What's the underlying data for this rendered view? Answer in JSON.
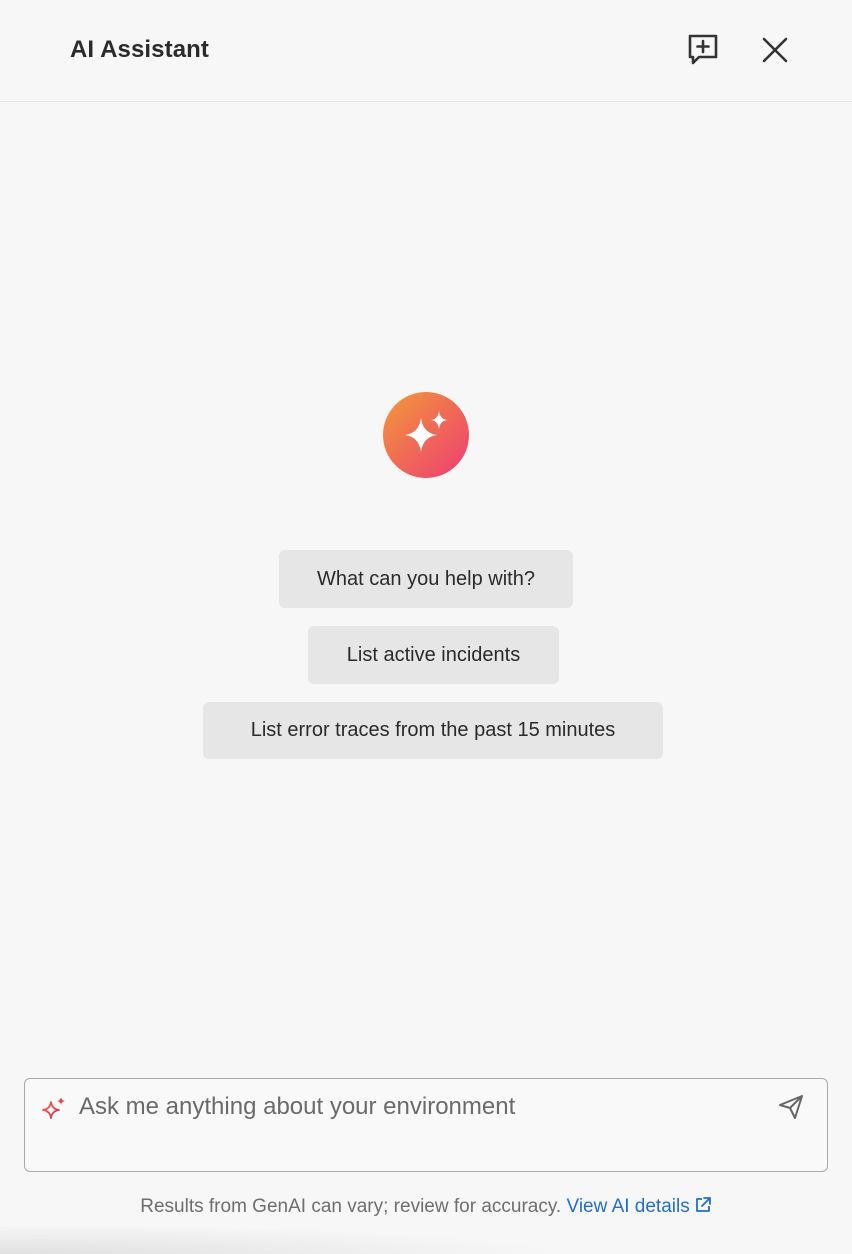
{
  "header": {
    "title": "AI Assistant",
    "new_chat_icon": "new-chat-icon",
    "close_icon": "close-icon"
  },
  "empty_state": {
    "logo_icon": "sparkle-icon",
    "suggestions": [
      "What can you help with?",
      "List active incidents",
      "List error traces from the past 15 minutes"
    ]
  },
  "input": {
    "placeholder": "Ask me anything about your environment",
    "value": "",
    "leading_icon": "sparkle-icon",
    "send_icon": "send-icon"
  },
  "footer": {
    "disclaimer": "Results from GenAI can vary; review for accuracy.",
    "link_label": "View AI details",
    "link_icon": "external-link-icon"
  },
  "colors": {
    "background": "#f7f7f7",
    "suggestion_bg": "#e6e6e6",
    "link": "#1f6fcf",
    "logo_gradient_start": "#f49a3a",
    "logo_gradient_end": "#ee3d77"
  }
}
